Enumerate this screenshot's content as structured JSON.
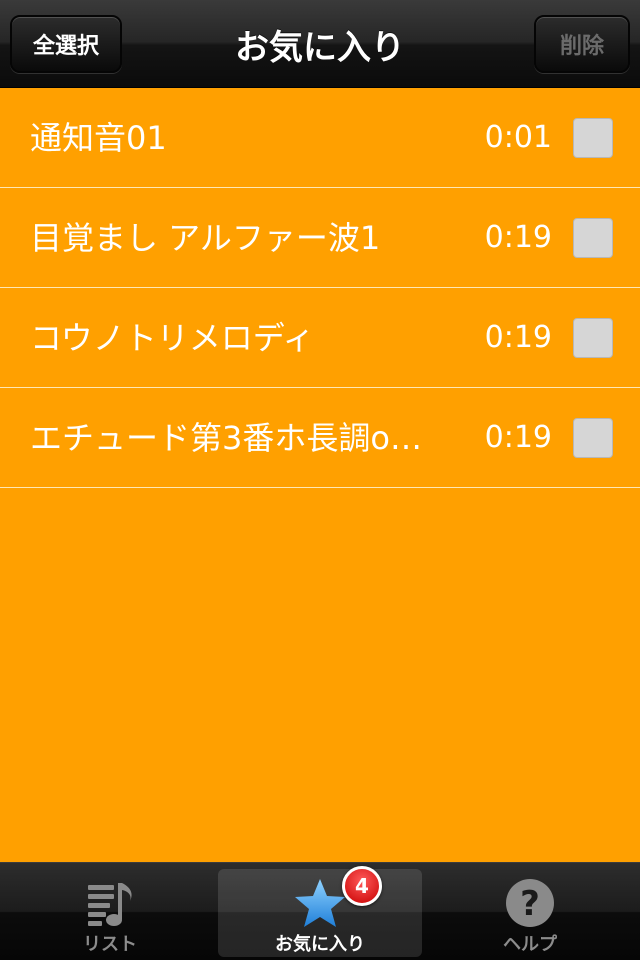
{
  "navbar": {
    "title": "お気に入り",
    "select_all_label": "全選択",
    "delete_label": "削除"
  },
  "list": {
    "items": [
      {
        "title": "通知音01",
        "duration": "0:01",
        "checked": false
      },
      {
        "title": "目覚まし アルファー波1",
        "duration": "0:19",
        "checked": false
      },
      {
        "title": "コウノトリメロディ",
        "duration": "0:19",
        "checked": false
      },
      {
        "title": "エチュード第3番ホ長調o…",
        "duration": "0:19",
        "checked": false
      }
    ]
  },
  "tabbar": {
    "tabs": [
      {
        "label": "リスト",
        "icon": "music-list-icon",
        "selected": false
      },
      {
        "label": "お気に入り",
        "icon": "star-icon",
        "selected": true,
        "badge": "4"
      },
      {
        "label": "ヘルプ",
        "icon": "help-question-icon",
        "selected": false
      }
    ]
  },
  "colors": {
    "background": "#ffa000",
    "row_divider": "#ffe7b4",
    "star": "#3fa4f0",
    "badge": "#d00000"
  }
}
